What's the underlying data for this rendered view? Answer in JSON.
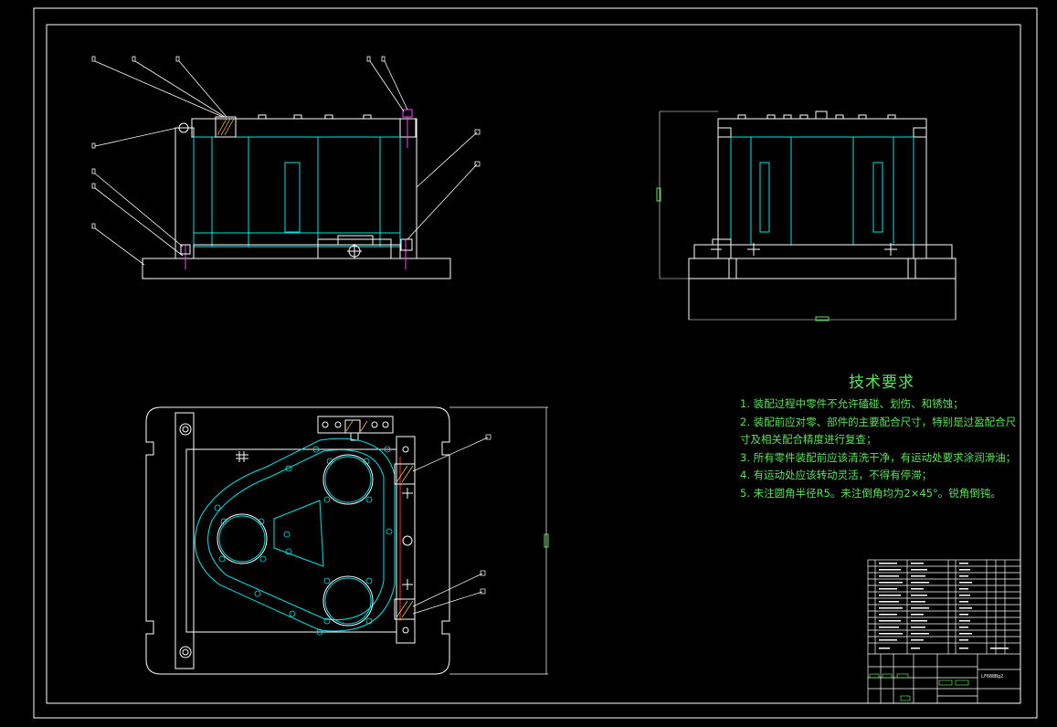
{
  "colors": {
    "background": "#000000",
    "frame": "#ffffff",
    "outline": "#ffffff",
    "hidden_parts": "#00e5e5",
    "highlight": "#ff40ff",
    "text": "#5be35b",
    "centerline": "#ff3030"
  },
  "tech_requirements": {
    "title": "技术要求",
    "items": [
      "1. 装配过程中零件不允许磕碰、划伤、和锈蚀；",
      "2. 装配前应对零、部件的主要配合尺寸，特别是过盈配合尺寸及相关配合精度进行复查；",
      "3. 所有零件装配前应该清洗干净，有运动处要求涂润滑油；",
      "4. 有运动处应该转动灵活，不得有停滞；",
      "5. 未注圆角半径R5。未注倒角均为2×45°。锐角倒钝。"
    ]
  },
  "title_block": {
    "drawing_no": "LF688Bg2",
    "views": [
      "front-view",
      "side-view",
      "top-view"
    ]
  }
}
